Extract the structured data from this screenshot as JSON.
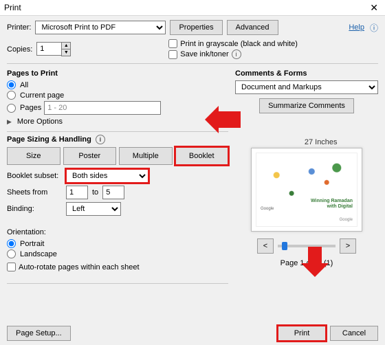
{
  "window": {
    "title": "Print",
    "help": "Help"
  },
  "top": {
    "printer_label": "Printer:",
    "printer_value": "Microsoft Print to PDF",
    "properties": "Properties",
    "advanced": "Advanced",
    "copies_label": "Copies:",
    "copies_value": "1",
    "grayscale": "Print in grayscale (black and white)",
    "save_ink": "Save ink/toner"
  },
  "pages": {
    "title": "Pages to Print",
    "all": "All",
    "current": "Current page",
    "pages_label": "Pages",
    "pages_range": "1 - 20",
    "more": "More Options"
  },
  "sizing": {
    "title": "Page Sizing & Handling",
    "tabs": {
      "size": "Size",
      "poster": "Poster",
      "multiple": "Multiple",
      "booklet": "Booklet"
    },
    "subset_label": "Booklet subset:",
    "subset_value": "Both sides",
    "sheets_from_label": "Sheets from",
    "sheets_from": "1",
    "sheets_to_label": "to",
    "sheets_to": "5",
    "binding_label": "Binding:",
    "binding_value": "Left"
  },
  "orientation": {
    "title": "Orientation:",
    "portrait": "Portrait",
    "landscape": "Landscape",
    "autorotate": "Auto-rotate pages within each sheet"
  },
  "comments": {
    "title": "Comments & Forms",
    "mode": "Document and Markups",
    "summarize": "Summarize Comments"
  },
  "preview": {
    "dimensions_suffix": "27 Inches",
    "logo": "Google",
    "caption_line1": "Winning Ramadan",
    "caption_line2": "with Digital",
    "page_label_prefix": "Page 1 o",
    "page_label_suffix": "0 (1)"
  },
  "footer": {
    "page_setup": "Page Setup...",
    "print": "Print",
    "cancel": "Cancel"
  }
}
